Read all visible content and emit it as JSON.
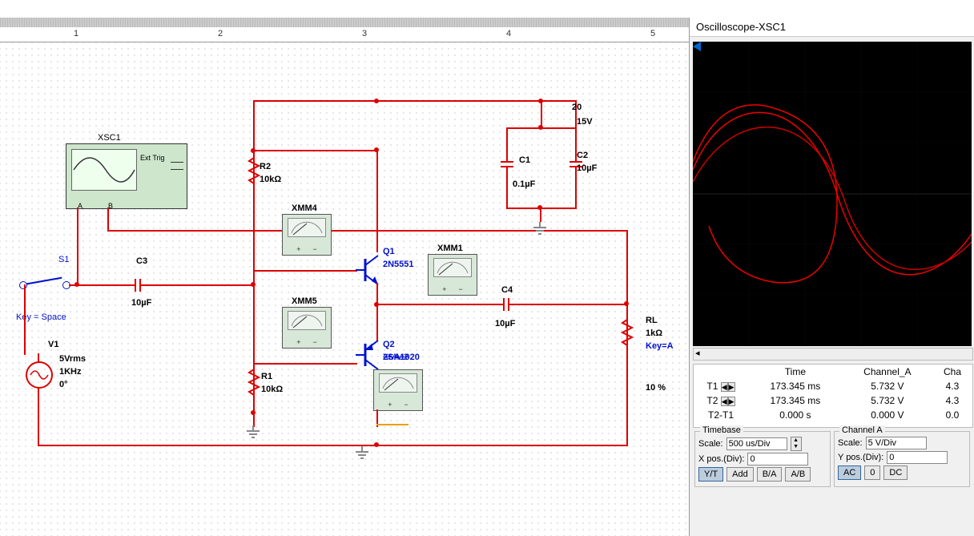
{
  "ruler": [
    "1",
    "2",
    "3",
    "4",
    "5"
  ],
  "scope_instance": {
    "name": "XSC1",
    "ext": "Ext Trig",
    "a": "A",
    "b": "B"
  },
  "switch": {
    "name": "S1",
    "key": "Key = Space"
  },
  "source": {
    "name": "V1",
    "amp": "5Vrms",
    "freq": "1KHz",
    "phase": "0°"
  },
  "r1": {
    "name": "R1",
    "val": "10kΩ"
  },
  "r2": {
    "name": "R2",
    "val": "10kΩ"
  },
  "rl": {
    "name": "RL",
    "val": "1kΩ",
    "key": "Key=A",
    "pct": "10 %"
  },
  "c1": {
    "name": "C1",
    "val": "0.1µF"
  },
  "c2": {
    "name": "C2",
    "val": "10µF"
  },
  "c3": {
    "name": "C3",
    "val": "10µF"
  },
  "c4": {
    "name": "C4",
    "val": "10µF"
  },
  "q1": {
    "name": "Q1",
    "model": "2N5551"
  },
  "q2": {
    "name": "Q2",
    "model": "2SA1020",
    "xmm": "XMM2"
  },
  "supply": {
    "node": "20",
    "val": "15V"
  },
  "xmm": {
    "m1": "XMM1",
    "m4": "XMM4",
    "m5": "XMM5"
  },
  "osc": {
    "title": "Oscilloscope-XSC1",
    "cursor_hdr": {
      "time": "Time",
      "cha": "Channel_A",
      "chb": "Cha"
    },
    "t1": {
      "lbl": "T1",
      "time": "173.345 ms",
      "a": "5.732 V",
      "b": "4.3"
    },
    "t2": {
      "lbl": "T2",
      "time": "173.345 ms",
      "a": "5.732 V",
      "b": "4.3"
    },
    "dt": {
      "lbl": "T2-T1",
      "time": "0.000 s",
      "a": "0.000 V",
      "b": "0.0"
    },
    "timebase": {
      "title": "Timebase",
      "scale_lbl": "Scale:",
      "scale": "500 us/Div",
      "xpos_lbl": "X pos.(Div):",
      "xpos": "0",
      "btns": [
        "Y/T",
        "Add",
        "B/A",
        "A/B"
      ]
    },
    "cha": {
      "title": "Channel A",
      "scale_lbl": "Scale:",
      "scale": "5 V/Div",
      "ypos_lbl": "Y pos.(Div):",
      "ypos": "0",
      "btns": [
        "AC",
        "0",
        "DC"
      ]
    }
  }
}
